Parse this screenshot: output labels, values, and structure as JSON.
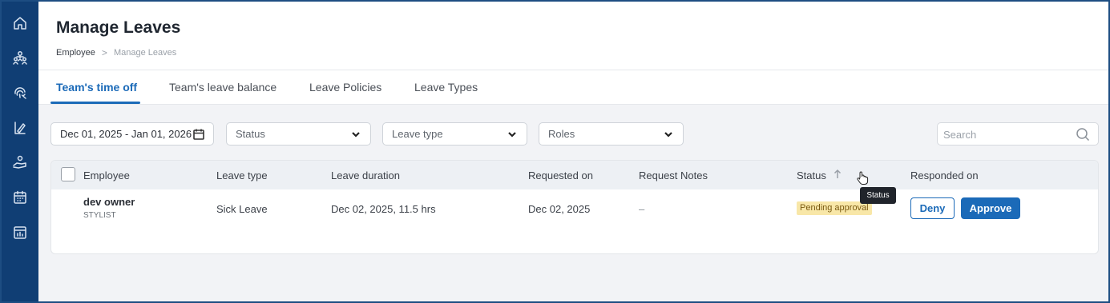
{
  "page": {
    "title": "Manage Leaves",
    "breadcrumb": {
      "root": "Employee",
      "separator": ">",
      "current": "Manage Leaves"
    }
  },
  "sidebar": {
    "items": [
      {
        "icon": "home-icon"
      },
      {
        "icon": "team-icon"
      },
      {
        "icon": "fingerprint-icon"
      },
      {
        "icon": "leave-icon"
      },
      {
        "icon": "hand-care-icon"
      },
      {
        "icon": "calendar-icon"
      },
      {
        "icon": "report-icon"
      }
    ]
  },
  "tabs": [
    {
      "label": "Team's time off",
      "active": true
    },
    {
      "label": "Team's leave balance",
      "active": false
    },
    {
      "label": "Leave Policies",
      "active": false
    },
    {
      "label": "Leave Types",
      "active": false
    }
  ],
  "filters": {
    "date_range": "Dec 01, 2025 - Jan 01, 2026",
    "status": "Status",
    "leave_type": "Leave type",
    "roles": "Roles",
    "search_placeholder": "Search"
  },
  "table": {
    "columns": [
      "Employee",
      "Leave type",
      "Leave duration",
      "Requested on",
      "Request Notes",
      "Status",
      "Responded on"
    ],
    "rows": [
      {
        "employee_name": "dev owner",
        "employee_role": "STYLIST",
        "leave_type": "Sick Leave",
        "leave_duration": "Dec 02, 2025, 11.5 hrs",
        "requested_on": "Dec 02, 2025",
        "request_notes": "–",
        "status": "Pending approval",
        "actions": {
          "deny": "Deny",
          "approve": "Approve"
        }
      }
    ]
  },
  "tooltip": "Status",
  "colors": {
    "sidebar": "#103e74",
    "accent": "#1b6ab8",
    "pending_badge_bg": "#f8e7a8",
    "header_bg": "#edf0f4"
  }
}
